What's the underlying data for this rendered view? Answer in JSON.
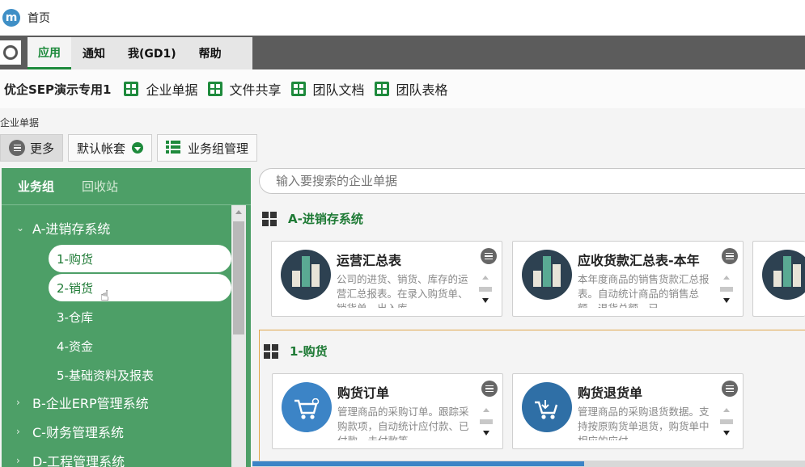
{
  "window": {
    "title": "首页",
    "logo_letter": "m"
  },
  "menu": {
    "tabs": [
      "应用",
      "通知",
      "我(GD1)",
      "帮助"
    ]
  },
  "quickbar": {
    "company": "优企SEP演示专用1",
    "items": [
      "企业单据",
      "文件共享",
      "团队文档",
      "团队表格"
    ]
  },
  "section_label": "企业单据",
  "toolbar": {
    "more": "更多",
    "account": "默认帐套",
    "group_manage": "业务组管理"
  },
  "sidebar": {
    "tabs": [
      "业务组",
      "回收站"
    ],
    "tree": {
      "group_a": "A-进销存系统",
      "children": [
        "1-购货",
        "2-销货",
        "3-仓库",
        "4-资金",
        "5-基础资料及报表"
      ],
      "group_b": "B-企业ERP管理系统",
      "group_c": "C-财务管理系统",
      "group_d": "D-工程管理系统"
    }
  },
  "search": {
    "placeholder": "输入要搜索的企业单据"
  },
  "main": {
    "group_a_title": "A-进销存系统",
    "cards_a": [
      {
        "title": "运营汇总表",
        "desc": "公司的进货、销货、库存的运营汇总报表。在录入购货单、销货单、出入库"
      },
      {
        "title": "应收货款汇总表-本年",
        "desc": "本年度商品的销售货款汇总报表。自动统计商品的销售总额、退货总额、已"
      }
    ],
    "group_1_title": "1-购货",
    "cards_1": [
      {
        "title": "购货订单",
        "desc": "管理商品的采购订单。跟踪采购款项，自动统计应付款、已付款、未付款等"
      },
      {
        "title": "购货退货单",
        "desc": "管理商品的采购退货数据。支持按原购货单退货，购货单中相应的应付"
      }
    ]
  },
  "colors": {
    "accent": "#1e8a3c",
    "sidebar": "#4d9f67"
  }
}
